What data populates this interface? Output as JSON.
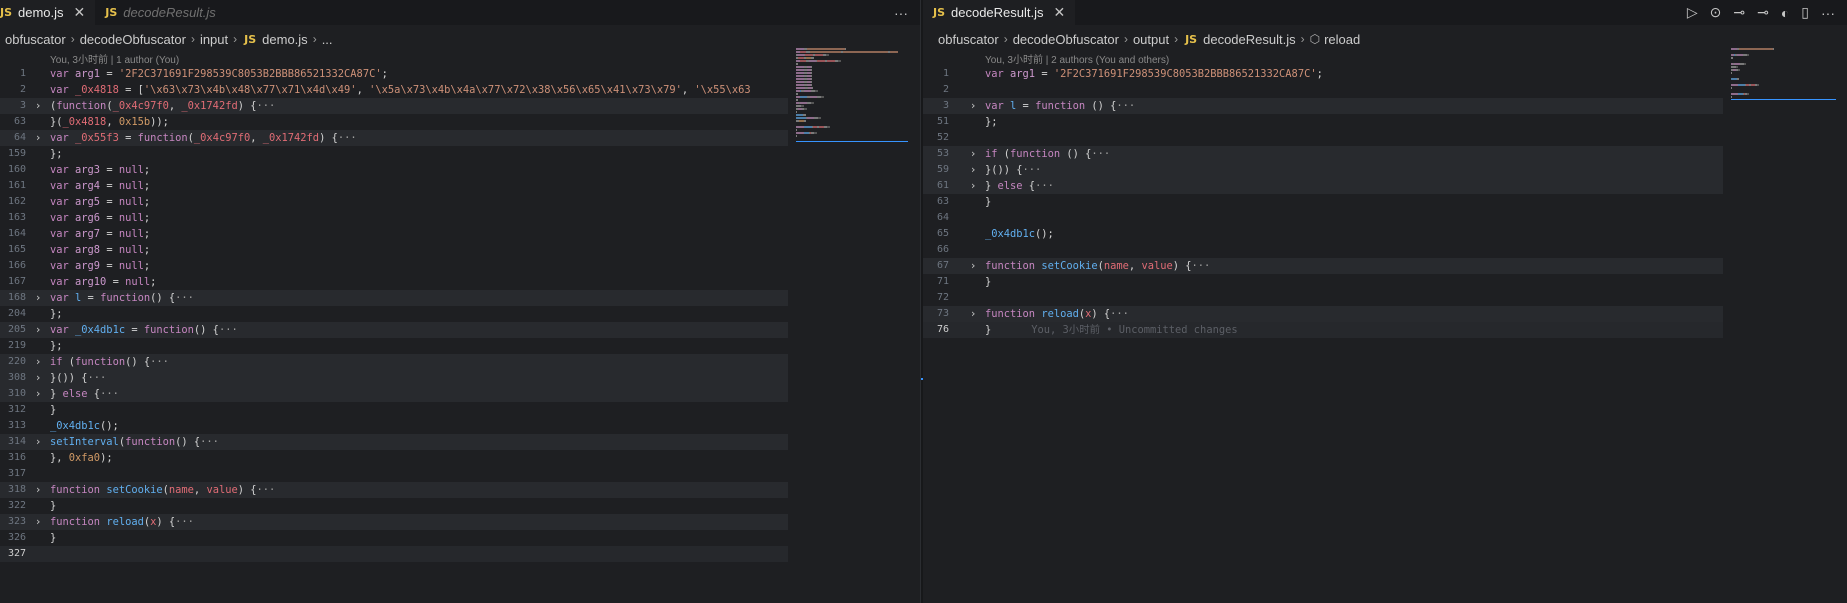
{
  "left": {
    "tabs": [
      {
        "badge": "JS",
        "label": "demo.js",
        "close": "✕"
      },
      {
        "badge": "JS",
        "label": "decodeResult.js"
      }
    ],
    "more": "···",
    "breadcrumb": [
      "obfuscator",
      "decodeObfuscator",
      "input",
      "demo.js",
      "..."
    ],
    "breadcrumb_sep": "›",
    "blame": "You, 3小时前 | 1 author (You)",
    "lines": [
      {
        "num": "1",
        "tokens": [
          [
            "var ",
            "k"
          ],
          [
            "arg1",
            "v"
          ],
          [
            " = ",
            "d"
          ],
          [
            "'2F2C371691F298539C8053B2BBB86521332CA87C'",
            "s"
          ],
          [
            ";",
            "d"
          ]
        ]
      },
      {
        "num": "2",
        "tokens": [
          [
            "var ",
            "k"
          ],
          [
            "_0x4818",
            "p"
          ],
          [
            " = [",
            "d"
          ],
          [
            "'\\x63\\x73\\x4b\\x48\\x77\\x71\\x4d\\x49'",
            "s"
          ],
          [
            ", ",
            "d"
          ],
          [
            "'\\x5a\\x73\\x4b\\x4a\\x77\\x72\\x38\\x56\\x65\\x41\\x73\\x79'",
            "s"
          ],
          [
            ", ",
            "d"
          ],
          [
            "'\\x55\\x63",
            "s"
          ]
        ]
      },
      {
        "num": "3",
        "fold": true,
        "tokens": [
          [
            "(",
            "d"
          ],
          [
            "function",
            "k"
          ],
          [
            "(",
            "d"
          ],
          [
            "_0x4c97f0",
            "p"
          ],
          [
            ", ",
            "d"
          ],
          [
            "_0x1742fd",
            "p"
          ],
          [
            ") {",
            "d"
          ],
          [
            "···",
            "el"
          ]
        ]
      },
      {
        "num": "63",
        "tokens": [
          [
            "}(",
            "d"
          ],
          [
            "_0x4818",
            "p"
          ],
          [
            ", ",
            "d"
          ],
          [
            "0x15b",
            "n"
          ],
          [
            "));",
            "d"
          ]
        ]
      },
      {
        "num": "64",
        "fold": true,
        "tokens": [
          [
            "var ",
            "k"
          ],
          [
            "_0x55f3",
            "p"
          ],
          [
            " = ",
            "d"
          ],
          [
            "function",
            "k"
          ],
          [
            "(",
            "d"
          ],
          [
            "_0x4c97f0",
            "p"
          ],
          [
            ", ",
            "d"
          ],
          [
            "_0x1742fd",
            "p"
          ],
          [
            ") {",
            "d"
          ],
          [
            "···",
            "el"
          ]
        ]
      },
      {
        "num": "159",
        "tokens": [
          [
            "};",
            "d"
          ]
        ]
      },
      {
        "num": "160",
        "tokens": [
          [
            "var ",
            "k"
          ],
          [
            "arg3",
            "v"
          ],
          [
            " = ",
            "d"
          ],
          [
            "null",
            "k"
          ],
          [
            ";",
            "d"
          ]
        ]
      },
      {
        "num": "161",
        "tokens": [
          [
            "var ",
            "k"
          ],
          [
            "arg4",
            "v"
          ],
          [
            " = ",
            "d"
          ],
          [
            "null",
            "k"
          ],
          [
            ";",
            "d"
          ]
        ]
      },
      {
        "num": "162",
        "tokens": [
          [
            "var ",
            "k"
          ],
          [
            "arg5",
            "v"
          ],
          [
            " = ",
            "d"
          ],
          [
            "null",
            "k"
          ],
          [
            ";",
            "d"
          ]
        ]
      },
      {
        "num": "163",
        "tokens": [
          [
            "var ",
            "k"
          ],
          [
            "arg6",
            "v"
          ],
          [
            " = ",
            "d"
          ],
          [
            "null",
            "k"
          ],
          [
            ";",
            "d"
          ]
        ]
      },
      {
        "num": "164",
        "tokens": [
          [
            "var ",
            "k"
          ],
          [
            "arg7",
            "v"
          ],
          [
            " = ",
            "d"
          ],
          [
            "null",
            "k"
          ],
          [
            ";",
            "d"
          ]
        ]
      },
      {
        "num": "165",
        "tokens": [
          [
            "var ",
            "k"
          ],
          [
            "arg8",
            "v"
          ],
          [
            " = ",
            "d"
          ],
          [
            "null",
            "k"
          ],
          [
            ";",
            "d"
          ]
        ]
      },
      {
        "num": "166",
        "tokens": [
          [
            "var ",
            "k"
          ],
          [
            "arg9",
            "v"
          ],
          [
            " = ",
            "d"
          ],
          [
            "null",
            "k"
          ],
          [
            ";",
            "d"
          ]
        ]
      },
      {
        "num": "167",
        "tokens": [
          [
            "var ",
            "k"
          ],
          [
            "arg10",
            "v"
          ],
          [
            " = ",
            "d"
          ],
          [
            "null",
            "k"
          ],
          [
            ";",
            "d"
          ]
        ]
      },
      {
        "num": "168",
        "fold": true,
        "tokens": [
          [
            "var ",
            "k"
          ],
          [
            "l",
            "f"
          ],
          [
            " = ",
            "d"
          ],
          [
            "function",
            "k"
          ],
          [
            "() {",
            "d"
          ],
          [
            "···",
            "el"
          ]
        ]
      },
      {
        "num": "204",
        "tokens": [
          [
            "};",
            "d"
          ]
        ]
      },
      {
        "num": "205",
        "fold": true,
        "tokens": [
          [
            "var ",
            "k"
          ],
          [
            "_0x4db1c",
            "f"
          ],
          [
            " = ",
            "d"
          ],
          [
            "function",
            "k"
          ],
          [
            "() {",
            "d"
          ],
          [
            "···",
            "el"
          ]
        ]
      },
      {
        "num": "219",
        "tokens": [
          [
            "};",
            "d"
          ]
        ]
      },
      {
        "num": "220",
        "fold": true,
        "tokens": [
          [
            "if ",
            "k"
          ],
          [
            "(",
            "d"
          ],
          [
            "function",
            "k"
          ],
          [
            "() {",
            "d"
          ],
          [
            "···",
            "el"
          ]
        ]
      },
      {
        "num": "308",
        "fold": true,
        "tokens": [
          [
            "}()) {",
            "d"
          ],
          [
            "···",
            "el"
          ]
        ]
      },
      {
        "num": "310",
        "fold": true,
        "tokens": [
          [
            "} ",
            "d"
          ],
          [
            "else",
            "k"
          ],
          [
            " {",
            "d"
          ],
          [
            "···",
            "el"
          ]
        ]
      },
      {
        "num": "312",
        "tokens": [
          [
            "}",
            "d"
          ]
        ]
      },
      {
        "num": "313",
        "tokens": [
          [
            "_0x4db1c",
            "f"
          ],
          [
            "();",
            "d"
          ]
        ]
      },
      {
        "num": "314",
        "fold": true,
        "tokens": [
          [
            "setInterval",
            "f"
          ],
          [
            "(",
            "d"
          ],
          [
            "function",
            "k"
          ],
          [
            "() {",
            "d"
          ],
          [
            "···",
            "el"
          ]
        ]
      },
      {
        "num": "316",
        "tokens": [
          [
            "}, ",
            "d"
          ],
          [
            "0xfa0",
            "n"
          ],
          [
            ");",
            "d"
          ]
        ]
      },
      {
        "num": "317",
        "tokens": []
      },
      {
        "num": "318",
        "fold": true,
        "tokens": [
          [
            "function ",
            "k"
          ],
          [
            "setCookie",
            "f"
          ],
          [
            "(",
            "d"
          ],
          [
            "name",
            "p"
          ],
          [
            ", ",
            "d"
          ],
          [
            "value",
            "p"
          ],
          [
            ") {",
            "d"
          ],
          [
            "···",
            "el"
          ]
        ]
      },
      {
        "num": "322",
        "tokens": [
          [
            "}",
            "d"
          ]
        ]
      },
      {
        "num": "323",
        "fold": true,
        "tokens": [
          [
            "function ",
            "k"
          ],
          [
            "reload",
            "f"
          ],
          [
            "(",
            "d"
          ],
          [
            "x",
            "p"
          ],
          [
            ") {",
            "d"
          ],
          [
            "···",
            "el"
          ]
        ]
      },
      {
        "num": "326",
        "tokens": [
          [
            "}",
            "d"
          ]
        ]
      },
      {
        "num": "327",
        "current": true,
        "tokens": []
      }
    ]
  },
  "right": {
    "tab": {
      "badge": "JS",
      "label": "decodeResult.js",
      "close": "✕"
    },
    "actions": {
      "run": "▷",
      "git_compare": "⊙",
      "prev_change": "⊸",
      "next_change": "⊸",
      "timeline": "◐",
      "split": "▯",
      "more": "···"
    },
    "breadcrumb": [
      "obfuscator",
      "decodeObfuscator",
      "output",
      "decodeResult.js",
      "reload"
    ],
    "breadcrumb_sep": "›",
    "blame": "You, 3小时前 | 2 authors (You and others)",
    "ghost_text": "You, 3小时前 • Uncommitted changes",
    "lines": [
      {
        "num": "1",
        "tokens": [
          [
            "var ",
            "k"
          ],
          [
            "arg1",
            "v"
          ],
          [
            " = ",
            "d"
          ],
          [
            "'2F2C371691F298539C8053B2BBB86521332CA87C'",
            "s"
          ],
          [
            ";",
            "d"
          ]
        ]
      },
      {
        "num": "2",
        "tokens": []
      },
      {
        "num": "3",
        "fold": true,
        "tokens": [
          [
            "var ",
            "k"
          ],
          [
            "l",
            "f"
          ],
          [
            " = ",
            "d"
          ],
          [
            "function",
            "k"
          ],
          [
            " () {",
            "d"
          ],
          [
            "···",
            "el"
          ]
        ]
      },
      {
        "num": "51",
        "tokens": [
          [
            "};",
            "d"
          ]
        ]
      },
      {
        "num": "52",
        "tokens": []
      },
      {
        "num": "53",
        "fold": true,
        "tokens": [
          [
            "if ",
            "k"
          ],
          [
            "(",
            "d"
          ],
          [
            "function",
            "k"
          ],
          [
            " () {",
            "d"
          ],
          [
            "···",
            "el"
          ]
        ]
      },
      {
        "num": "59",
        "fold": true,
        "tokens": [
          [
            "}()) {",
            "d"
          ],
          [
            "···",
            "el"
          ]
        ]
      },
      {
        "num": "61",
        "fold": true,
        "tokens": [
          [
            "} ",
            "d"
          ],
          [
            "else",
            "k"
          ],
          [
            " {",
            "d"
          ],
          [
            "···",
            "el"
          ]
        ]
      },
      {
        "num": "63",
        "tokens": [
          [
            "}",
            "d"
          ]
        ]
      },
      {
        "num": "64",
        "tokens": []
      },
      {
        "num": "65",
        "tokens": [
          [
            "_0x4db1c",
            "f"
          ],
          [
            "();",
            "d"
          ]
        ]
      },
      {
        "num": "66",
        "tokens": []
      },
      {
        "num": "67",
        "fold": true,
        "tokens": [
          [
            "function ",
            "k"
          ],
          [
            "setCookie",
            "f"
          ],
          [
            "(",
            "d"
          ],
          [
            "name",
            "p"
          ],
          [
            ", ",
            "d"
          ],
          [
            "value",
            "p"
          ],
          [
            ") {",
            "d"
          ],
          [
            "···",
            "el"
          ]
        ]
      },
      {
        "num": "71",
        "tokens": [
          [
            "}",
            "d"
          ]
        ]
      },
      {
        "num": "72",
        "tokens": []
      },
      {
        "num": "73",
        "fold": true,
        "tokens": [
          [
            "function ",
            "k"
          ],
          [
            "reload",
            "f"
          ],
          [
            "(",
            "d"
          ],
          [
            "x",
            "p"
          ],
          [
            ") {",
            "d"
          ],
          [
            "···",
            "el"
          ]
        ]
      },
      {
        "num": "76",
        "current": true,
        "tokens": [
          [
            "}",
            "d"
          ]
        ],
        "ghost": true
      }
    ]
  },
  "colors": {
    "background": "#1e1f22",
    "keyword": "#c586c0",
    "string": "#ce9178",
    "function": "#61afef",
    "param": "#e06c75",
    "number": "#d19a66",
    "js_badge": "#e5c04b",
    "accent": "#3794ff"
  }
}
